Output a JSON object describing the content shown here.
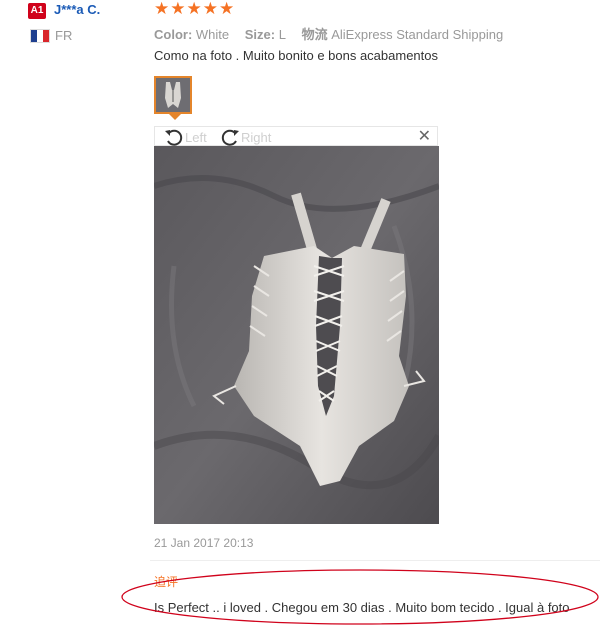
{
  "reviewer": {
    "level_badge": "A1",
    "name": "J***a C.",
    "country_code": "FR"
  },
  "review": {
    "stars": "★★★★★",
    "attributes": [
      {
        "key": "Color:",
        "value": "White"
      },
      {
        "key": "Size:",
        "value": "L"
      },
      {
        "key": "物流",
        "value": "AliExpress Standard Shipping"
      }
    ],
    "text": "Como na foto . Muito bonito e bons acabamentos",
    "date": "21 Jan 2017 20:13"
  },
  "viewer": {
    "rotate_left_label": "Left",
    "rotate_right_label": "Right",
    "close_glyph": "✕"
  },
  "followup": {
    "label": "追评",
    "text": "Is Perfect .. i loved . Chegou em 30 dias . Muito bom tecido . Igual à foto"
  },
  "colors": {
    "accent": "#f57224",
    "link": "#1a5ab6",
    "badge": "#d0021b",
    "annotation": "#d0021b"
  }
}
